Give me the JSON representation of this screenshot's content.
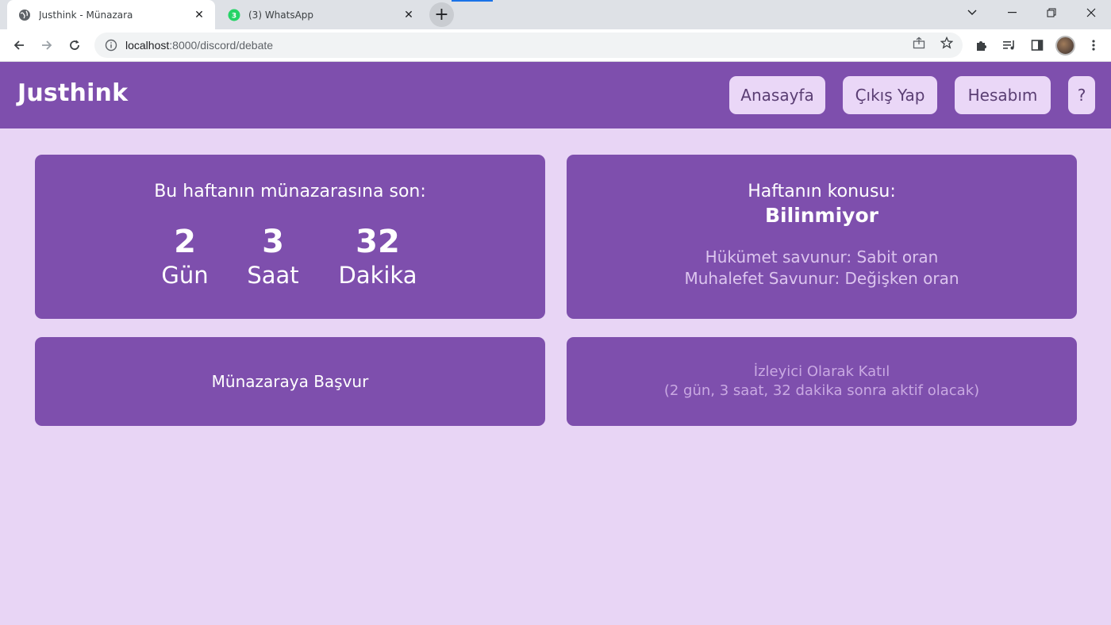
{
  "browser": {
    "tabs": [
      {
        "title": "Justhink - Münazara",
        "close": "✕"
      },
      {
        "title": "(3) WhatsApp",
        "badge": "3",
        "close": "✕"
      }
    ],
    "new_tab": "+",
    "url_host": "localhost",
    "url_rest": ":8000/discord/debate",
    "icons": {
      "tab1_favicon": "globe-icon",
      "tab2_favicon": "whatsapp-icon",
      "back": "arrow-left-icon",
      "forward": "arrow-right-icon",
      "reload": "reload-icon",
      "site_info": "info-icon",
      "share": "share-icon",
      "bookmark": "star-icon",
      "extensions": "puzzle-icon",
      "media": "media-control-icon",
      "side_panel": "side-panel-icon",
      "menu": "kebab-menu-icon"
    },
    "colors": {
      "accent": "#1a73e8"
    }
  },
  "app": {
    "brand": "Justhink",
    "nav": {
      "home": "Anasayfa",
      "logout": "Çıkış Yap",
      "account": "Hesabım",
      "help": "?"
    },
    "colors": {
      "primary": "#7e4fad",
      "background": "#e8d5f5",
      "nav_button": "#ead7f7"
    }
  },
  "countdown": {
    "heading": "Bu haftanın münazarasına son:",
    "days": {
      "value": "2",
      "unit": "Gün"
    },
    "hours": {
      "value": "3",
      "unit": "Saat"
    },
    "minutes": {
      "value": "32",
      "unit": "Dakika"
    }
  },
  "topic": {
    "heading": "Haftanın konusu:",
    "title": "Bilinmiyor",
    "government": "Hükümet savunur: Sabit oran",
    "opposition": "Muhalefet Savunur: Değişken oran"
  },
  "apply": {
    "label": "Münazaraya Başvur"
  },
  "watch": {
    "label": "İzleyici Olarak Katıl",
    "note": "(2 gün, 3 saat, 32 dakika sonra aktif olacak)"
  }
}
